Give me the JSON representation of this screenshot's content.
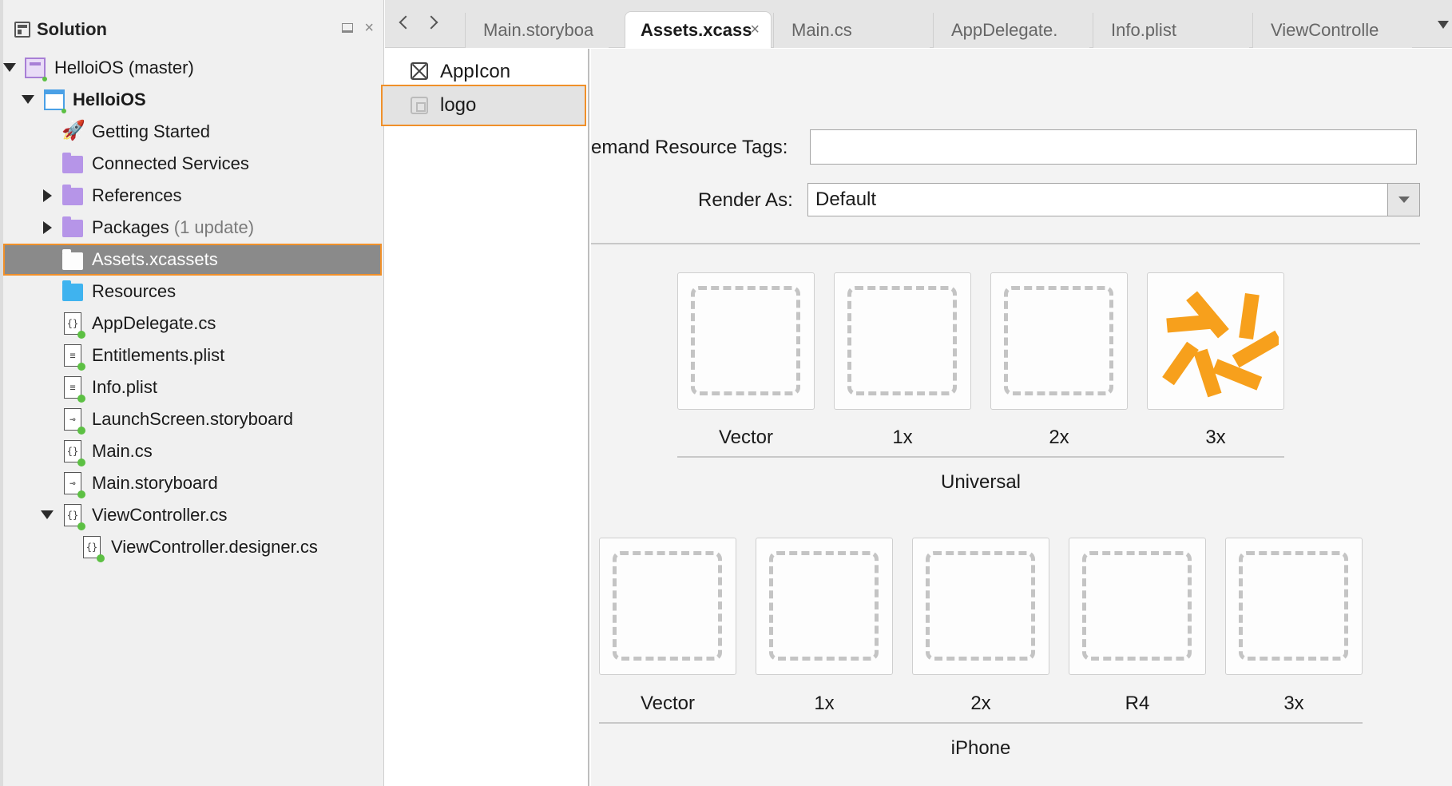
{
  "solution_pad": {
    "title": "Solution",
    "items": [
      {
        "label": "HelloiOS (master)",
        "kind": "solution",
        "expanded": true
      },
      {
        "label": "HelloiOS",
        "kind": "project",
        "expanded": true
      },
      {
        "label": "Getting Started",
        "kind": "rocket"
      },
      {
        "label": "Connected Services",
        "kind": "folder"
      },
      {
        "label": "References",
        "kind": "folder",
        "expanded": false
      },
      {
        "label": "Packages",
        "extra": "(1 update)",
        "kind": "folder",
        "expanded": false
      },
      {
        "label": "Assets.xcassets",
        "kind": "folder-white",
        "selected": true
      },
      {
        "label": "Resources",
        "kind": "folder-blue"
      },
      {
        "label": "AppDelegate.cs",
        "kind": "file-cs"
      },
      {
        "label": "Entitlements.plist",
        "kind": "file-plist"
      },
      {
        "label": "Info.plist",
        "kind": "file-plist"
      },
      {
        "label": "LaunchScreen.storyboard",
        "kind": "file-storyboard"
      },
      {
        "label": "Main.cs",
        "kind": "file-cs"
      },
      {
        "label": "Main.storyboard",
        "kind": "file-storyboard"
      },
      {
        "label": "ViewController.cs",
        "kind": "file-cs",
        "expanded": true
      },
      {
        "label": "ViewController.designer.cs",
        "kind": "file-cs"
      }
    ]
  },
  "tabs": [
    {
      "label": "Main.storyboa"
    },
    {
      "label": "Assets.xcass",
      "active": true,
      "close": "×"
    },
    {
      "label": "Main.cs"
    },
    {
      "label": "AppDelegate."
    },
    {
      "label": "Info.plist"
    },
    {
      "label": "ViewControlle"
    }
  ],
  "asset_list": [
    {
      "label": "AppIcon",
      "icon": "appicon-icon"
    },
    {
      "label": "logo",
      "icon": "image-set-icon",
      "selected": true
    }
  ],
  "inspector": {
    "odr_label": "emand Resource Tags:",
    "odr_value": "",
    "render_as_label": "Render As:",
    "render_as_value": "Default"
  },
  "universal_group": {
    "title": "Universal",
    "slots": [
      {
        "label": "Vector",
        "filled": false
      },
      {
        "label": "1x",
        "filled": false
      },
      {
        "label": "2x",
        "filled": false
      },
      {
        "label": "3x",
        "filled": true
      }
    ]
  },
  "iphone_group": {
    "title": "iPhone",
    "slots": [
      {
        "label": "Vector"
      },
      {
        "label": "1x"
      },
      {
        "label": "2x"
      },
      {
        "label": "R4"
      },
      {
        "label": "3x"
      }
    ]
  },
  "colors": {
    "selection_outline": "#f0902a",
    "logo_orange": "#f7a01c"
  }
}
